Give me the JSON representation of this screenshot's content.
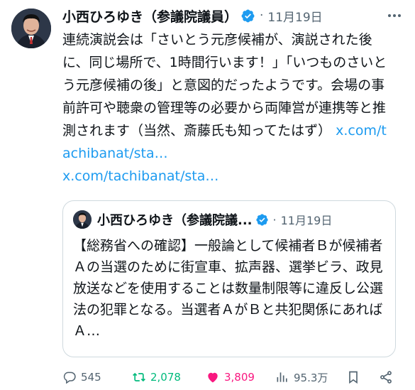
{
  "tweet": {
    "author_name": "小西ひろゆき（参議院議員）",
    "date": "11月19日",
    "separator": "·",
    "text": "連続演説会は「さいとう元彦候補が、演説された後に、同じ場所で、1時間行います！」「いつものさいとう元彦候補の後」と意図的だったようです。会場の事前許可や聴衆の管理等の必要から両陣営が連携等と推測されます（当然、斎藤氏も知ってたはず）",
    "link1": "x.com/tachibanat/sta…",
    "link2": "x.com/tachibanat/sta…"
  },
  "quote": {
    "author_name": "小西ひろゆき（参議院議...",
    "separator": "·",
    "date": "11月19日",
    "text": "【総務省への確認】一般論として候補者Ｂが候補者Ａの当選のために街宣車、拡声器、選挙ビラ、政見放送などを使用することは数量制限等に違反し公選法の犯罪となる。当選者ＡがＢと共犯関係にあればＡ…"
  },
  "actions": {
    "replies": "545",
    "retweets": "2,078",
    "likes": "3,809",
    "views": "95.3万"
  },
  "colors": {
    "link": "#1d9bf0",
    "retweet": "#00ba7c",
    "like": "#f91880",
    "muted": "#536471",
    "verified": "#1d9bf0"
  }
}
